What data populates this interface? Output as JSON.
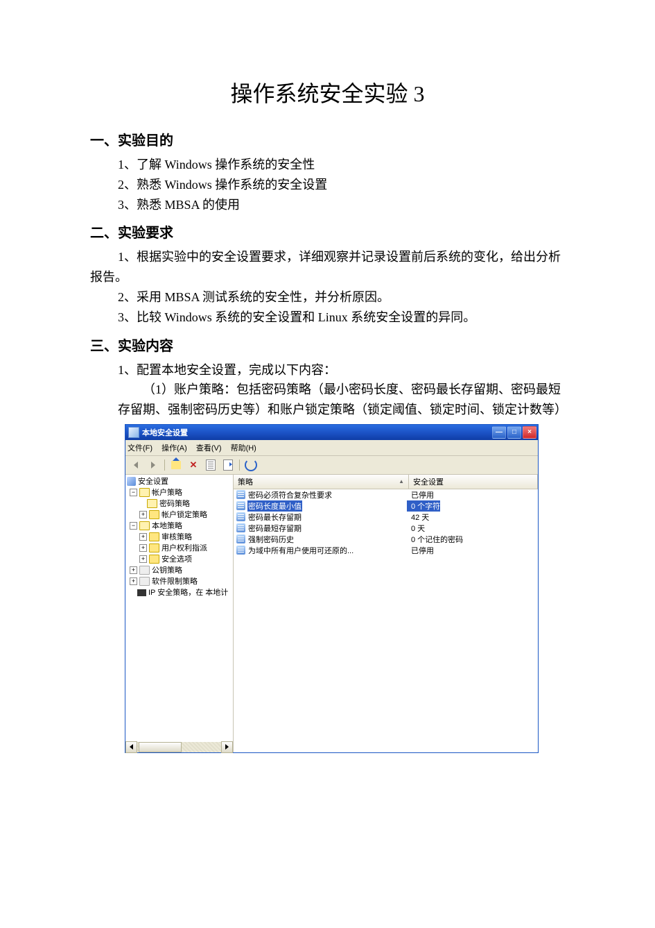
{
  "title": "操作系统安全实验 3",
  "sections": {
    "s1": {
      "heading": "一、实验目的",
      "items": [
        "1、了解 Windows 操作系统的安全性",
        "2、熟悉 Windows 操作系统的安全设置",
        "3、熟悉 MBSA 的使用"
      ]
    },
    "s2": {
      "heading": "二、实验要求",
      "paras": [
        "1、根据实验中的安全设置要求，详细观察并记录设置前后系统的变化，给出分析报告。",
        "2、采用 MBSA 测试系统的安全性，并分析原因。",
        "3、比较 Windows 系统的安全设置和 Linux 系统安全设置的异同。"
      ]
    },
    "s3": {
      "heading": "三、实验内容",
      "p1": "1、配置本地安全设置，完成以下内容：",
      "p2": "（1）账户策略：包括密码策略（最小密码长度、密码最长存留期、密码最短存留期、强制密码历史等）和账户锁定策略（锁定阈值、锁定时间、锁定计数等）"
    }
  },
  "win": {
    "title": "本地安全设置",
    "menu": {
      "file": "文件(F)",
      "action": "操作(A)",
      "view": "查看(V)",
      "help": "帮助(H)"
    },
    "tree": {
      "root": "安全设置",
      "n1": "帐户策略",
      "n1a": "密码策略",
      "n1b": "帐户锁定策略",
      "n2": "本地策略",
      "n2a": "审核策略",
      "n2b": "用户权利指派",
      "n2c": "安全选项",
      "n3": "公钥策略",
      "n4": "软件限制策略",
      "n5": "IP 安全策略，在 本地计"
    },
    "cols": {
      "c1": "策略",
      "c2": "安全设置"
    },
    "rows": [
      {
        "name": "密码必须符合复杂性要求",
        "val": "已停用"
      },
      {
        "name": "密码长度最小值",
        "val": "0 个字符"
      },
      {
        "name": "密码最长存留期",
        "val": "42 天"
      },
      {
        "name": "密码最短存留期",
        "val": "0 天"
      },
      {
        "name": "强制密码历史",
        "val": "0 个记住的密码"
      },
      {
        "name": "为域中所有用户使用可还原的...",
        "val": "已停用"
      }
    ]
  }
}
